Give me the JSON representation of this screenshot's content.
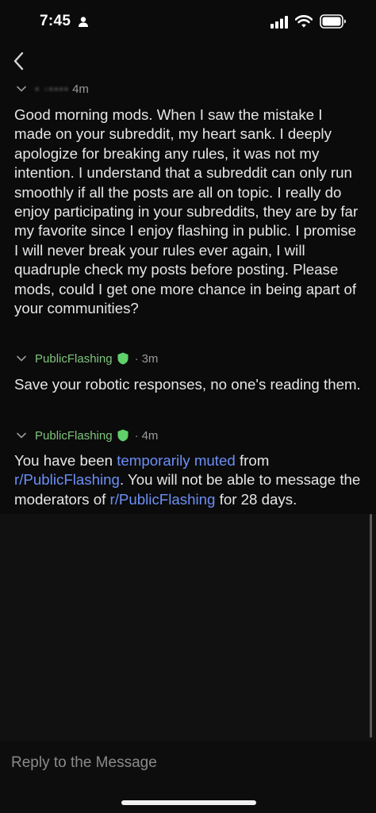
{
  "status_bar": {
    "time": "7:45",
    "icons": [
      "person-icon",
      "signal-icon",
      "wifi-icon",
      "battery-icon"
    ]
  },
  "nav": {
    "back_icon": "chevron-left-icon"
  },
  "messages": [
    {
      "author": "",
      "time_ago": "4m",
      "body": "Good morning mods. When I saw the mistake I made on your subreddit, my heart sank. I deeply apologize for breaking any rules, it was not my intention. I understand that a subreddit can only run smoothly if all the posts are all on topic. I really do enjoy participating in your subreddits, they are by far my favorite since I enjoy flashing in public. I promise I will never break your rules ever again, I will quadruple check my posts before posting. Please mods, could I get one more chance in being apart of your communities?"
    },
    {
      "author": "PublicFlashing",
      "separator": "·",
      "time_ago": "3m",
      "body": "Save your robotic responses, no one's reading them."
    },
    {
      "author": "PublicFlashing",
      "separator": "·",
      "time_ago": "4m",
      "body_parts": {
        "p1": "You have been ",
        "link1": "temporarily muted",
        "p2": " from ",
        "link2": "r/PublicFlashing",
        "p3": ". You will not be able to message the moderators of ",
        "link3": "r/PublicFlashing",
        "p4": " for 28 days."
      }
    }
  ],
  "reply": {
    "placeholder": "Reply to the Message"
  },
  "colors": {
    "background": "#0b0b0b",
    "text": "#e6e6e6",
    "mod_name": "#7ec47e",
    "mod_shield": "#5fd16a",
    "link": "#6c8ff7"
  }
}
